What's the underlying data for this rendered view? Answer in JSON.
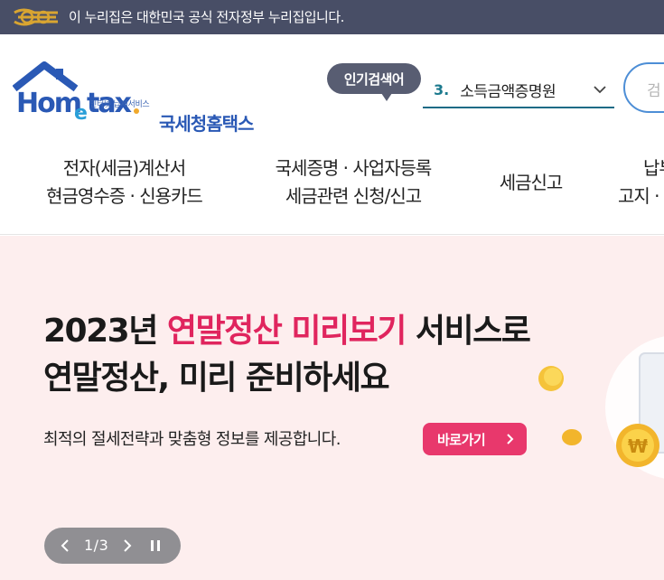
{
  "gov_banner": {
    "text": "이 누리집은 대한민국 공식 전자정부 누리집입니다.",
    "logo_icon": "egov-logo-icon"
  },
  "logo": {
    "small_text": "인터넷 납세서비스",
    "brand_en": "Hometax.",
    "brand_ko": "국세청홈택스"
  },
  "popular_search": {
    "label": "인기검색어",
    "rank": "3.",
    "term": "소득금액증명원"
  },
  "search": {
    "placeholder": "검"
  },
  "nav": [
    {
      "line1": "전자(세금)계산서",
      "line2": "현금영수증 · 신용카드"
    },
    {
      "line1": "국세증명 · 사업자등록",
      "line2": "세금관련 신청/신고"
    },
    {
      "line1": "세금신고",
      "line2": ""
    },
    {
      "line1": "납부",
      "line2": "고지 ·"
    }
  ],
  "hero": {
    "title_year": "2023년 ",
    "title_accent": "연말정산 미리보기",
    "title_rest": " 서비스로",
    "title_line2": "연말정산, 미리 준비하세요",
    "subtitle": "최적의 절세전략과 맞춤형 정보를 제공합니다.",
    "cta_label": "바로가기",
    "coin_symbol": "₩",
    "pager": "1/3"
  },
  "colors": {
    "gov_bar": "#484e66",
    "brand_blue": "#2a59b5",
    "accent_pink": "#e0255e",
    "hero_bg": "#fdeeee",
    "cta_bg": "#e8386c"
  }
}
